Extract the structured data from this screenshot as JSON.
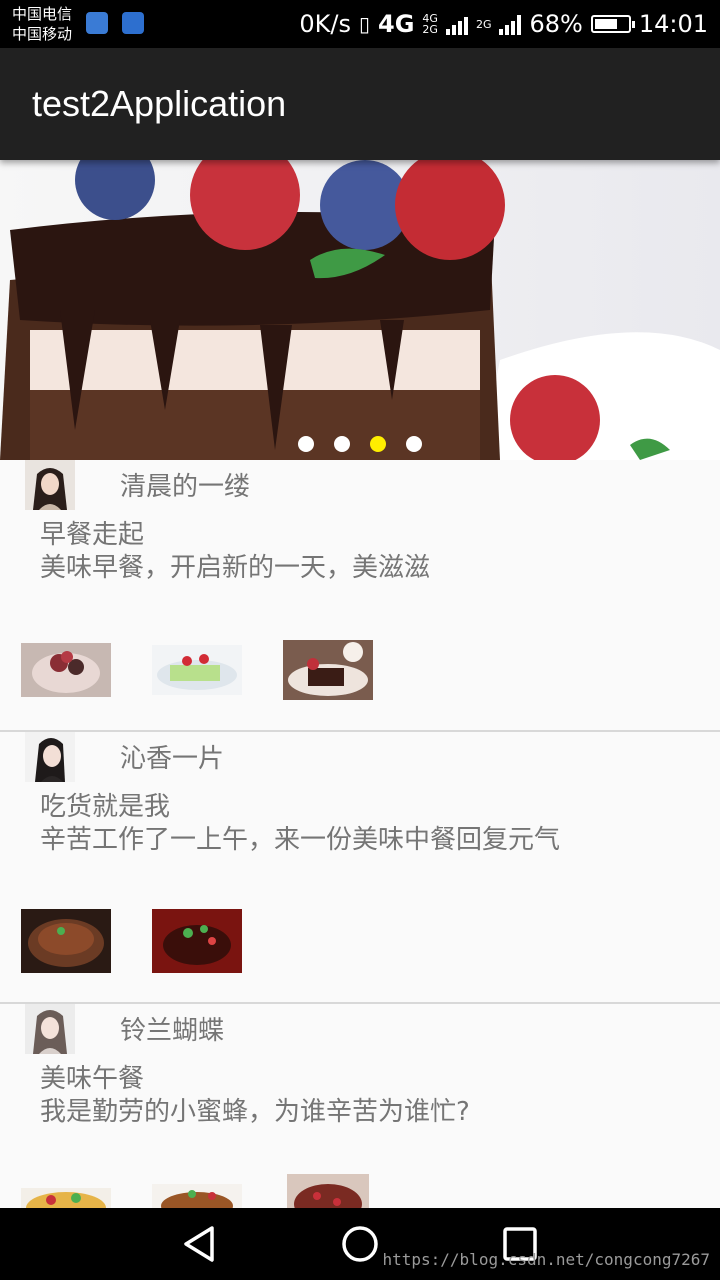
{
  "status_bar": {
    "carrier_1": "中国电信",
    "carrier_2": "中国移动",
    "net_speed": "0K/s",
    "net_type_1": "4G",
    "sig_label_a": "4G",
    "sig_label_b": "2G",
    "sig_label_c": "2G",
    "battery_text": "68%",
    "battery_level": 0.68,
    "time": "14:01"
  },
  "app_bar": {
    "title": "test2Application"
  },
  "banner": {
    "page_count": 4,
    "active_index": 2,
    "active_color": "#ffee00"
  },
  "posts": [
    {
      "author": "清晨的一缕",
      "title": "早餐走起",
      "body": "美味早餐，开启新的一天，美滋滋"
    },
    {
      "author": "沁香一片",
      "title": "吃货就是我",
      "body": "辛苦工作了一上午，来一份美味中餐回复元气"
    },
    {
      "author": "铃兰蝴蝶",
      "title": "美味午餐",
      "body": "我是勤劳的小蜜蜂，为谁辛苦为谁忙?"
    }
  ],
  "nav_bar": {
    "icons": [
      "back-icon",
      "home-icon",
      "recents-icon"
    ]
  },
  "watermark": "https://blog.csdn.net/congcong7267"
}
